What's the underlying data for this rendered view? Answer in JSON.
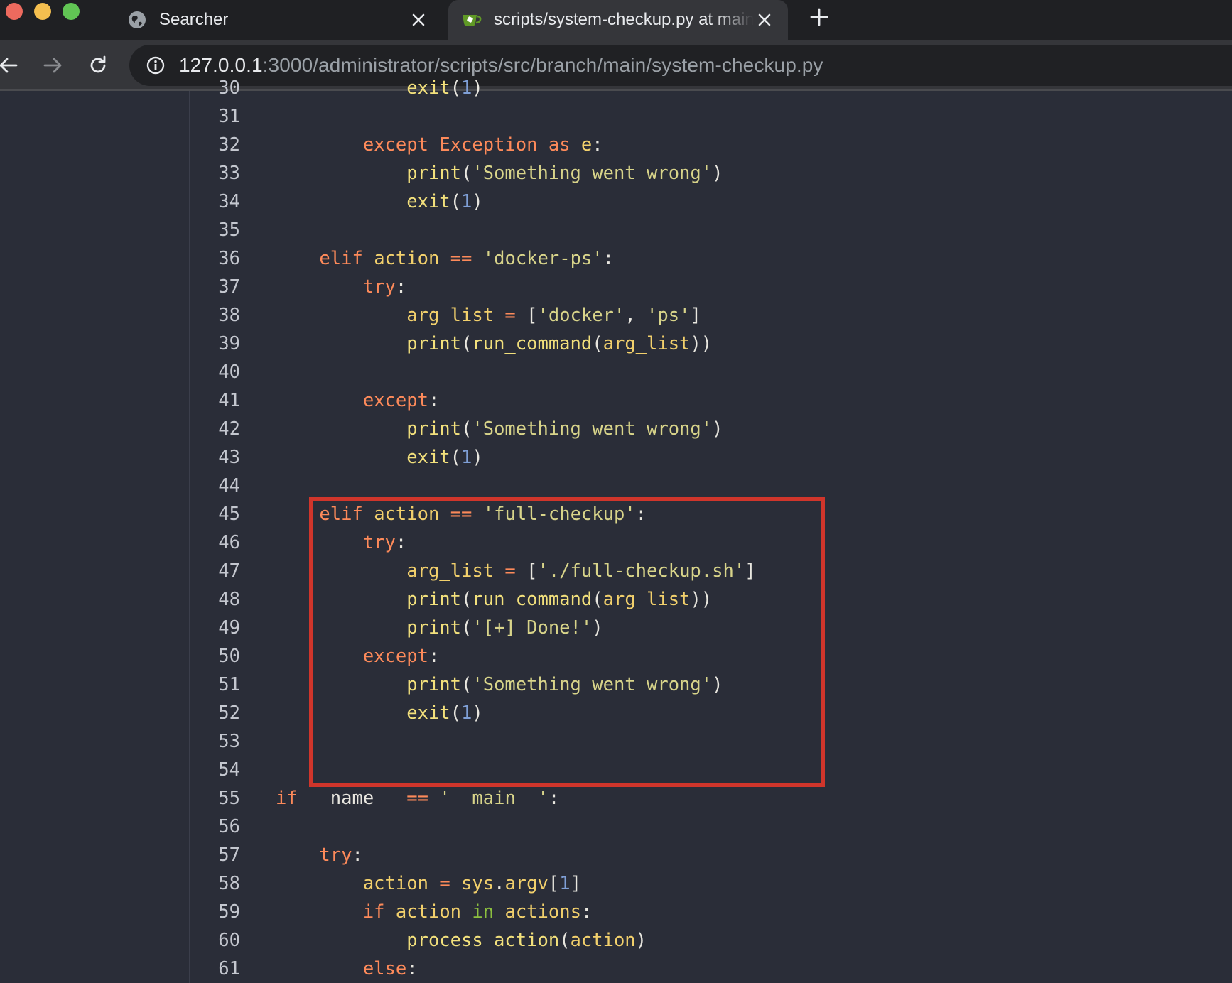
{
  "browser": {
    "tabs": [
      {
        "title": "Searcher",
        "active": false,
        "favicon": "globe-icon"
      },
      {
        "title": "scripts/system-checkup.py at main",
        "active": true,
        "favicon": "gitea-icon"
      }
    ],
    "url_host": "127.0.0.1",
    "url_rest": ":3000/administrator/scripts/src/branch/main/system-checkup.py"
  },
  "colors": {
    "highlight_box": "#d0352b",
    "keyword": "#fd8a5a",
    "function": "#f2e07c",
    "string": "#d8d48a",
    "number": "#7f9fd6"
  },
  "code_lines": [
    {
      "n": "30",
      "tokens": [
        [
          "p",
          "            "
        ],
        [
          "fn",
          "exit"
        ],
        [
          "p",
          "("
        ],
        [
          "num",
          "1"
        ],
        [
          "p",
          ")"
        ]
      ]
    },
    {
      "n": "31",
      "tokens": []
    },
    {
      "n": "32",
      "tokens": [
        [
          "p",
          "        "
        ],
        [
          "kw",
          "except"
        ],
        [
          "p",
          " "
        ],
        [
          "cls",
          "Exception"
        ],
        [
          "p",
          " "
        ],
        [
          "kw",
          "as"
        ],
        [
          "p",
          " "
        ],
        [
          "var",
          "e"
        ],
        [
          "p",
          ":"
        ]
      ]
    },
    {
      "n": "33",
      "tokens": [
        [
          "p",
          "            "
        ],
        [
          "fn",
          "print"
        ],
        [
          "p",
          "("
        ],
        [
          "str",
          "'Something went wrong'"
        ],
        [
          "p",
          ")"
        ]
      ]
    },
    {
      "n": "34",
      "tokens": [
        [
          "p",
          "            "
        ],
        [
          "fn",
          "exit"
        ],
        [
          "p",
          "("
        ],
        [
          "num",
          "1"
        ],
        [
          "p",
          ")"
        ]
      ]
    },
    {
      "n": "35",
      "tokens": []
    },
    {
      "n": "36",
      "tokens": [
        [
          "p",
          "    "
        ],
        [
          "kw",
          "elif"
        ],
        [
          "p",
          " "
        ],
        [
          "var",
          "action"
        ],
        [
          "p",
          " "
        ],
        [
          "op",
          "=="
        ],
        [
          "p",
          " "
        ],
        [
          "str",
          "'docker-ps'"
        ],
        [
          "p",
          ":"
        ]
      ]
    },
    {
      "n": "37",
      "tokens": [
        [
          "p",
          "        "
        ],
        [
          "kw",
          "try"
        ],
        [
          "p",
          ":"
        ]
      ]
    },
    {
      "n": "38",
      "tokens": [
        [
          "p",
          "            "
        ],
        [
          "var",
          "arg_list"
        ],
        [
          "p",
          " "
        ],
        [
          "op",
          "="
        ],
        [
          "p",
          " ["
        ],
        [
          "str",
          "'docker'"
        ],
        [
          "p",
          ", "
        ],
        [
          "str",
          "'ps'"
        ],
        [
          "p",
          "]"
        ]
      ]
    },
    {
      "n": "39",
      "tokens": [
        [
          "p",
          "            "
        ],
        [
          "fn",
          "print"
        ],
        [
          "p",
          "("
        ],
        [
          "fn",
          "run_command"
        ],
        [
          "p",
          "("
        ],
        [
          "var",
          "arg_list"
        ],
        [
          "p",
          "))"
        ]
      ]
    },
    {
      "n": "40",
      "tokens": []
    },
    {
      "n": "41",
      "tokens": [
        [
          "p",
          "        "
        ],
        [
          "kw",
          "except"
        ],
        [
          "p",
          ":"
        ]
      ]
    },
    {
      "n": "42",
      "tokens": [
        [
          "p",
          "            "
        ],
        [
          "fn",
          "print"
        ],
        [
          "p",
          "("
        ],
        [
          "str",
          "'Something went wrong'"
        ],
        [
          "p",
          ")"
        ]
      ]
    },
    {
      "n": "43",
      "tokens": [
        [
          "p",
          "            "
        ],
        [
          "fn",
          "exit"
        ],
        [
          "p",
          "("
        ],
        [
          "num",
          "1"
        ],
        [
          "p",
          ")"
        ]
      ]
    },
    {
      "n": "44",
      "tokens": []
    },
    {
      "n": "45",
      "tokens": [
        [
          "p",
          "    "
        ],
        [
          "kw",
          "elif"
        ],
        [
          "p",
          " "
        ],
        [
          "var",
          "action"
        ],
        [
          "p",
          " "
        ],
        [
          "op",
          "=="
        ],
        [
          "p",
          " "
        ],
        [
          "str",
          "'full-checkup'"
        ],
        [
          "p",
          ":"
        ]
      ]
    },
    {
      "n": "46",
      "tokens": [
        [
          "p",
          "        "
        ],
        [
          "kw",
          "try"
        ],
        [
          "p",
          ":"
        ]
      ]
    },
    {
      "n": "47",
      "tokens": [
        [
          "p",
          "            "
        ],
        [
          "var",
          "arg_list"
        ],
        [
          "p",
          " "
        ],
        [
          "op",
          "="
        ],
        [
          "p",
          " ["
        ],
        [
          "str",
          "'./full-checkup.sh'"
        ],
        [
          "p",
          "]"
        ]
      ]
    },
    {
      "n": "48",
      "tokens": [
        [
          "p",
          "            "
        ],
        [
          "fn",
          "print"
        ],
        [
          "p",
          "("
        ],
        [
          "fn",
          "run_command"
        ],
        [
          "p",
          "("
        ],
        [
          "var",
          "arg_list"
        ],
        [
          "p",
          "))"
        ]
      ]
    },
    {
      "n": "49",
      "tokens": [
        [
          "p",
          "            "
        ],
        [
          "fn",
          "print"
        ],
        [
          "p",
          "("
        ],
        [
          "str",
          "'[+] Done!'"
        ],
        [
          "p",
          ")"
        ]
      ]
    },
    {
      "n": "50",
      "tokens": [
        [
          "p",
          "        "
        ],
        [
          "kw",
          "except"
        ],
        [
          "p",
          ":"
        ]
      ]
    },
    {
      "n": "51",
      "tokens": [
        [
          "p",
          "            "
        ],
        [
          "fn",
          "print"
        ],
        [
          "p",
          "("
        ],
        [
          "str",
          "'Something went wrong'"
        ],
        [
          "p",
          ")"
        ]
      ]
    },
    {
      "n": "52",
      "tokens": [
        [
          "p",
          "            "
        ],
        [
          "fn",
          "exit"
        ],
        [
          "p",
          "("
        ],
        [
          "num",
          "1"
        ],
        [
          "p",
          ")"
        ]
      ]
    },
    {
      "n": "53",
      "tokens": []
    },
    {
      "n": "54",
      "tokens": []
    },
    {
      "n": "55",
      "tokens": [
        [
          "kw",
          "if"
        ],
        [
          "p",
          " __name__ "
        ],
        [
          "op",
          "=="
        ],
        [
          "p",
          " "
        ],
        [
          "str",
          "'__main__'"
        ],
        [
          "p",
          ":"
        ]
      ]
    },
    {
      "n": "56",
      "tokens": []
    },
    {
      "n": "57",
      "tokens": [
        [
          "p",
          "    "
        ],
        [
          "kw",
          "try"
        ],
        [
          "p",
          ":"
        ]
      ]
    },
    {
      "n": "58",
      "tokens": [
        [
          "p",
          "        "
        ],
        [
          "var",
          "action"
        ],
        [
          "p",
          " "
        ],
        [
          "op",
          "="
        ],
        [
          "p",
          " "
        ],
        [
          "var",
          "sys"
        ],
        [
          "p",
          "."
        ],
        [
          "var",
          "argv"
        ],
        [
          "p",
          "["
        ],
        [
          "num",
          "1"
        ],
        [
          "p",
          "]"
        ]
      ]
    },
    {
      "n": "59",
      "tokens": [
        [
          "p",
          "        "
        ],
        [
          "kw",
          "if"
        ],
        [
          "p",
          " "
        ],
        [
          "var",
          "action"
        ],
        [
          "p",
          " "
        ],
        [
          "in",
          "in"
        ],
        [
          "p",
          " "
        ],
        [
          "var",
          "actions"
        ],
        [
          "p",
          ":"
        ]
      ]
    },
    {
      "n": "60",
      "tokens": [
        [
          "p",
          "            "
        ],
        [
          "fn",
          "process_action"
        ],
        [
          "p",
          "("
        ],
        [
          "var",
          "action"
        ],
        [
          "p",
          ")"
        ]
      ]
    },
    {
      "n": "61",
      "tokens": [
        [
          "p",
          "        "
        ],
        [
          "kw",
          "else"
        ],
        [
          "p",
          ":"
        ]
      ]
    }
  ]
}
